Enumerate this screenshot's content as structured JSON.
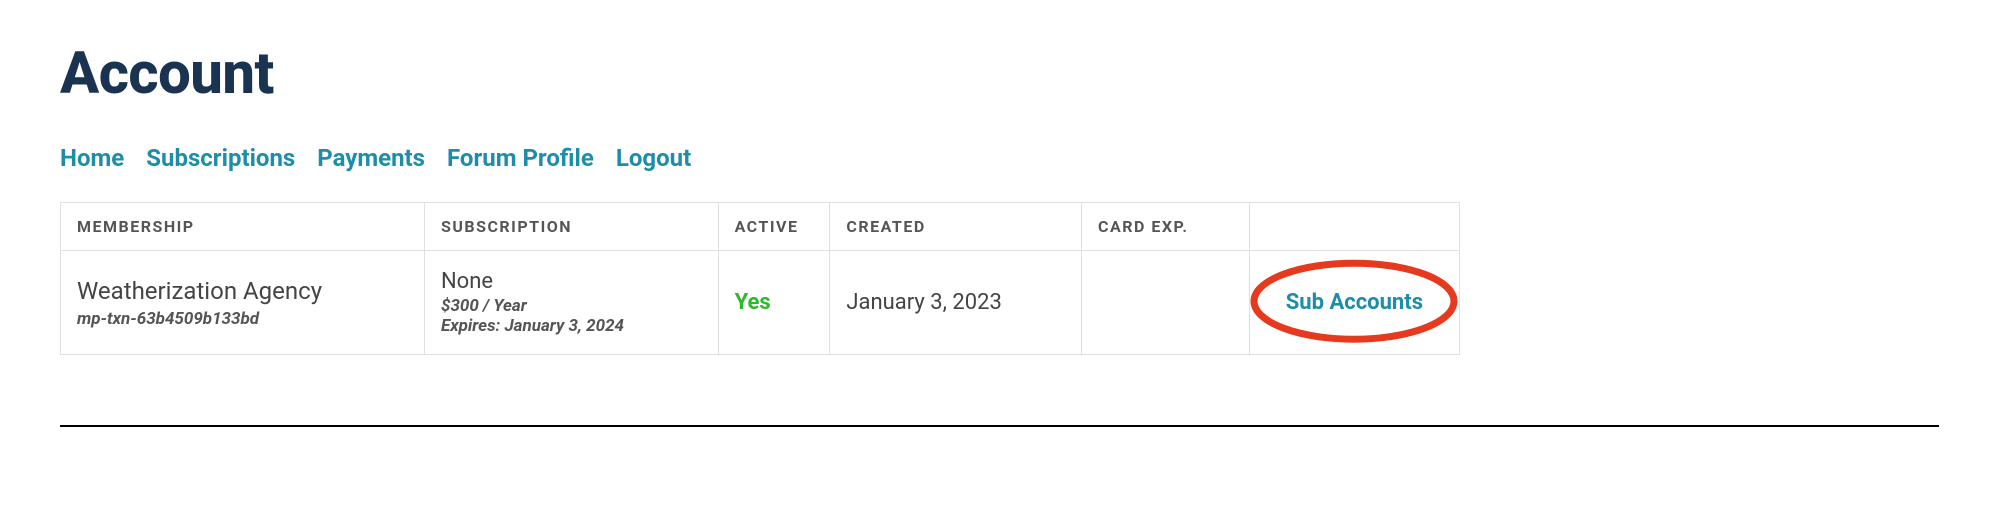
{
  "page": {
    "title": "Account"
  },
  "nav": {
    "home": "Home",
    "subscriptions": "Subscriptions",
    "payments": "Payments",
    "forum_profile": "Forum Profile",
    "logout": "Logout"
  },
  "table": {
    "headers": {
      "membership": "Membership",
      "subscription": "Subscription",
      "active": "Active",
      "created": "Created",
      "card_exp": "Card Exp."
    },
    "row": {
      "membership_name": "Weatherization Agency",
      "membership_txn": "mp-txn-63b4509b133bd",
      "subscription_name": "None",
      "subscription_price": "$300 / Year",
      "subscription_expires": "Expires: January 3, 2024",
      "active": "Yes",
      "created": "January 3, 2023",
      "card_exp": "",
      "sub_accounts_label": "Sub Accounts"
    }
  },
  "annotation": {
    "color": "#e63a1e"
  }
}
